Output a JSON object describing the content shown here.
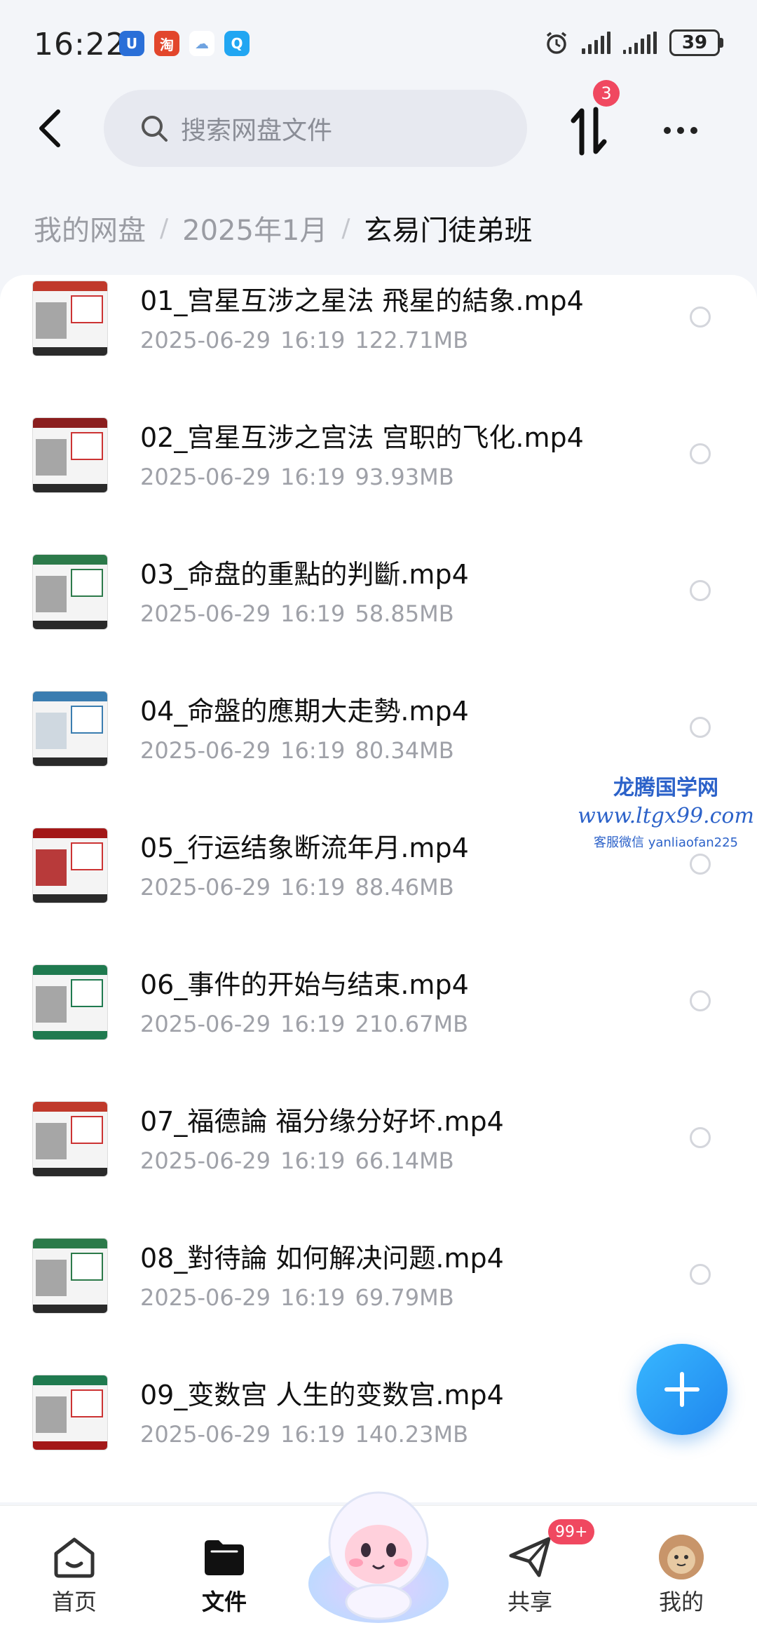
{
  "status_bar": {
    "time": "16:22",
    "battery": "39",
    "apps": [
      {
        "name": "app-icon-blue",
        "color": "#2a6fd8",
        "glyph": "U"
      },
      {
        "name": "app-icon-taobao",
        "color": "#e2462c",
        "glyph": "淘"
      },
      {
        "name": "app-icon-cloud",
        "color": "#ffffff",
        "glyph": "☁"
      },
      {
        "name": "app-icon-search",
        "color": "#21a6f2",
        "glyph": "Q"
      }
    ]
  },
  "header": {
    "search_placeholder": "搜索网盘文件",
    "transfer_badge": "3"
  },
  "breadcrumb": {
    "items": [
      "我的网盘",
      "2025年1月"
    ],
    "current": "玄易门徒弟班"
  },
  "files": [
    {
      "name": "01_宫星互涉之星法 飛星的結象.mp4",
      "meta": "2025-06-29  16:19  122.71MB",
      "accent": "#c0392b"
    },
    {
      "name": "02_宫星互涉之宫法 宫职的飞化.mp4",
      "meta": "2025-06-29  16:19  93.93MB",
      "accent": "#8b1e1e"
    },
    {
      "name": "03_命盘的重點的判斷.mp4",
      "meta": "2025-06-29  16:19  58.85MB",
      "accent": "#2c7a4a"
    },
    {
      "name": "04_命盤的應期大走勢.mp4",
      "meta": "2025-06-29  16:19  80.34MB",
      "accent": "#3a7db0"
    },
    {
      "name": "05_行运结象断流年月.mp4",
      "meta": "2025-06-29  16:19  88.46MB",
      "accent": "#a31818"
    },
    {
      "name": "06_事件的开始与结束.mp4",
      "meta": "2025-06-29  16:19  210.67MB",
      "accent": "#1f7a4f"
    },
    {
      "name": "07_福德論 福分缘分好坏.mp4",
      "meta": "2025-06-29  16:19  66.14MB",
      "accent": "#c0392b"
    },
    {
      "name": "08_對待論 如何解决问题.mp4",
      "meta": "2025-06-29  16:19  69.79MB",
      "accent": "#2c7a4a"
    },
    {
      "name": "09_变数宫 人生的变数宫.mp4",
      "meta": "2025-06-29  16:19  140.23MB",
      "accent": "#1f7a4f"
    }
  ],
  "watermark": {
    "title": "龙腾国学网",
    "url": "www.ltgx99.com",
    "contact": "客服微信 yanliaofan225"
  },
  "bottom_nav": {
    "home": "首页",
    "files": "文件",
    "share": "共享",
    "share_badge": "99+",
    "me": "我的"
  },
  "colors": {
    "accent": "#2d8cf0",
    "badge": "#f04860"
  }
}
